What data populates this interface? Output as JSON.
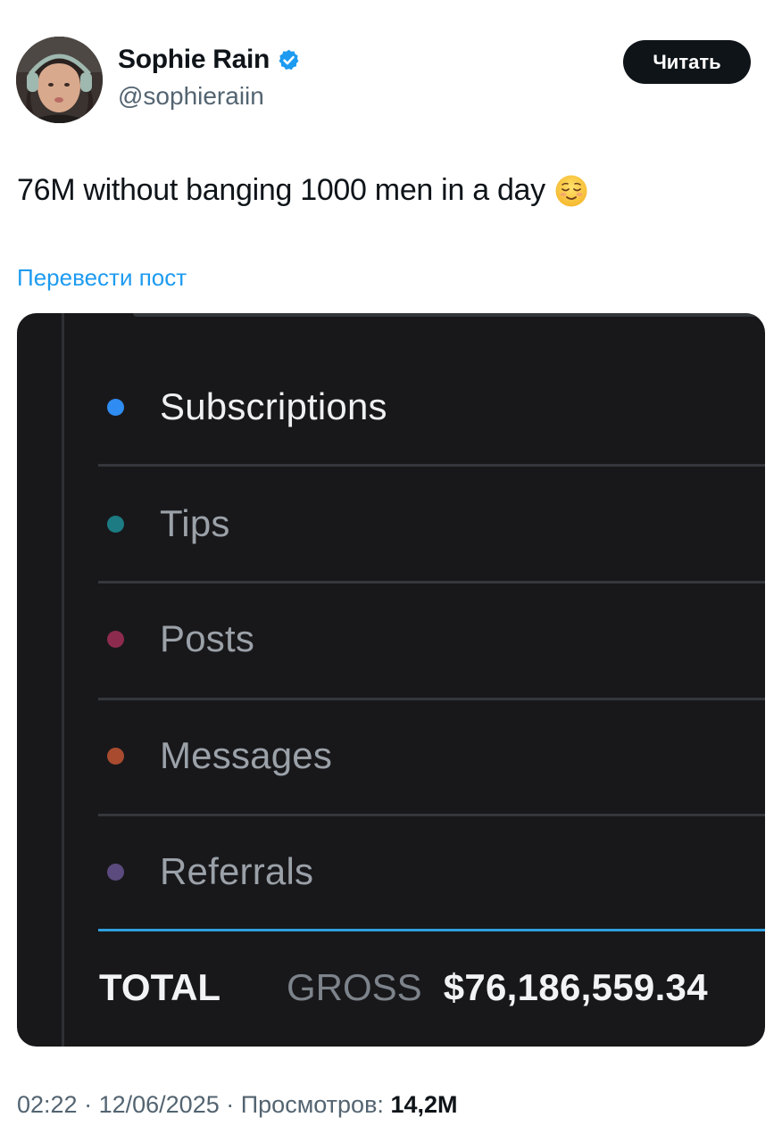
{
  "author": {
    "name": "Sophie Rain",
    "handle": "@sophieraiin",
    "verified": true,
    "avatar_icon": "profile-photo"
  },
  "follow_button": {
    "label": "Читать"
  },
  "tweet": {
    "text": "76M without banging 1000 men in a day",
    "emoji": "relieved-face"
  },
  "translate_link": "Перевести пост",
  "media": {
    "categories": [
      {
        "label": "Subscriptions",
        "color": "#2f8cf2",
        "active": true
      },
      {
        "label": "Tips",
        "color": "#1c7b83",
        "active": false
      },
      {
        "label": "Posts",
        "color": "#8d2b4f",
        "active": false
      },
      {
        "label": "Messages",
        "color": "#a94b2f",
        "active": false
      },
      {
        "label": "Referrals",
        "color": "#5b4a7d",
        "active": false
      }
    ],
    "total": {
      "label": "TOTAL",
      "gross_label": "GROSS",
      "gross_value": "$76,186,559.34"
    }
  },
  "meta": {
    "time": "02:22",
    "date": "12/06/2025",
    "views_label": "Просмотров:",
    "views_count": "14,2M"
  },
  "colors": {
    "verified_badge": "#1d9bf0",
    "link": "#1d9bf0",
    "media_bg": "#18181b",
    "accent_line": "#2e9fde"
  }
}
